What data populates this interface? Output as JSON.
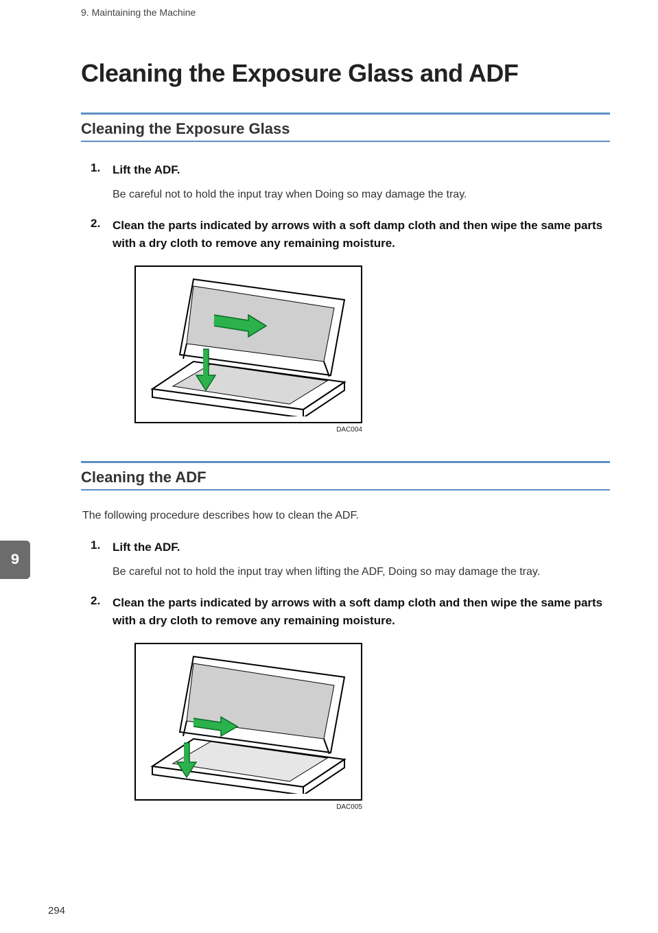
{
  "runningHead": "9. Maintaining the Machine",
  "pageTitle": "Cleaning the Exposure Glass and ADF",
  "tabNumber": "9",
  "pageNumber": "294",
  "sections": [
    {
      "heading": "Cleaning the Exposure Glass",
      "intro": "",
      "steps": [
        {
          "head": "Lift the ADF.",
          "body": "Be careful not to hold the input tray when Doing so may damage the tray."
        },
        {
          "head": "Clean the parts indicated by arrows with a soft damp cloth and then wipe the same parts with a dry cloth to remove any remaining moisture.",
          "body": ""
        }
      ],
      "figureCaption": "DAC004"
    },
    {
      "heading": "Cleaning the ADF",
      "intro": "The following procedure describes how to clean the ADF.",
      "steps": [
        {
          "head": "Lift the ADF.",
          "body": "Be careful not to hold the input tray when lifting the ADF, Doing so may damage the tray."
        },
        {
          "head": "Clean the parts indicated by arrows with a soft damp cloth and then wipe the same parts with a dry cloth to remove any remaining moisture.",
          "body": ""
        }
      ],
      "figureCaption": "DAC005"
    }
  ]
}
